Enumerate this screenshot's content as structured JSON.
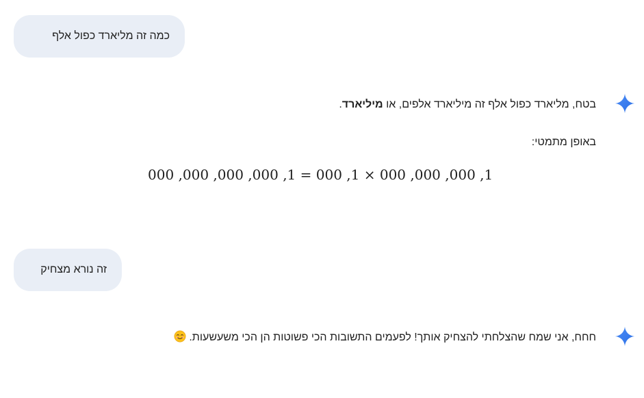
{
  "conversation": {
    "user_message_1": "כמה זה מליארד כפול אלף",
    "reply_1": {
      "text_before": "בטח, מליארד כפול אלף זה מיליארד אלפים, או ",
      "bold": "מיליארד",
      "text_after": ".",
      "line_2": "באופן מתמטי:",
      "math": "000 ,000 ,000 ,000 ,1 = 000 ,1 × 000 ,000 ,000 ,1"
    },
    "user_message_2": "זה נורא מצחיק",
    "reply_2": {
      "text": "חחח, אני שמח שהצלחתי להצחיק אותך! לפעמים התשובות הכי פשוטות הן הכי משעשעות.",
      "emoji_icon": "smiling-face-emoji"
    }
  },
  "colors": {
    "user_bubble_bg": "#e9eef6",
    "text": "#1f1f1f",
    "spark_start": "#4285f4",
    "spark_end": "#9b72cb"
  },
  "icons": {
    "assistant_avatar": "gemini-sparkle-icon"
  }
}
